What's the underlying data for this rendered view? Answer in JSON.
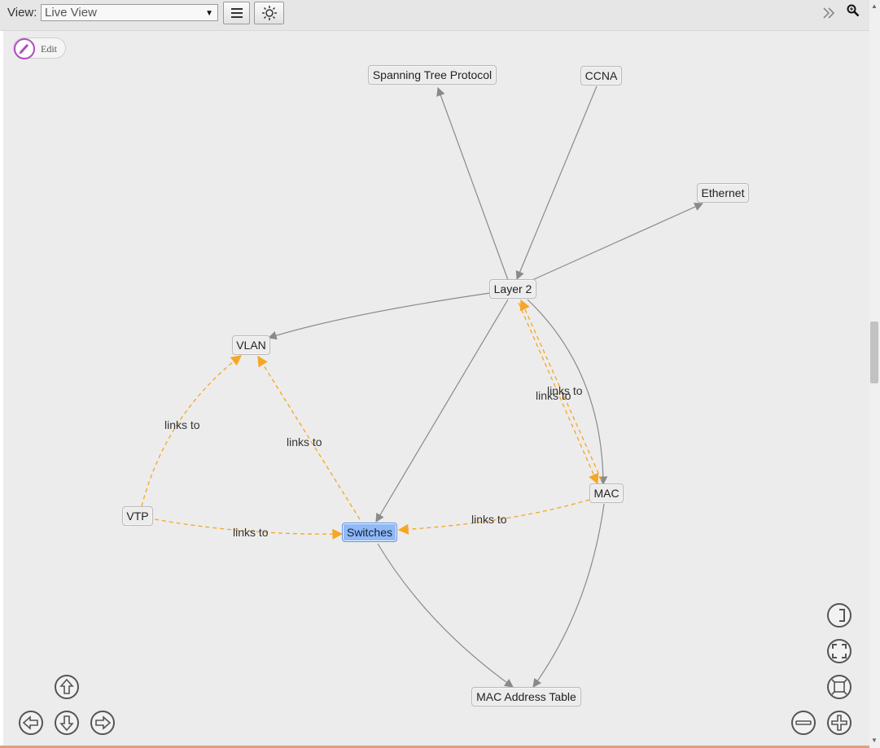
{
  "toolbar": {
    "view_label": "View:",
    "view_value": "Live View"
  },
  "edit_label": "Edit",
  "nodes": {
    "stp": "Spanning Tree Protocol",
    "ccna": "CCNA",
    "ethernet": "Ethernet",
    "layer2": "Layer 2",
    "vlan": "VLAN",
    "mac": "MAC",
    "vtp": "VTP",
    "switches": "Switches",
    "mac_table": "MAC Address Table"
  },
  "edge_labels": {
    "vtp_vlan": "links to",
    "switches_vlan": "links to",
    "layer2_mac_a": "links to",
    "layer2_mac_b": "links to",
    "mac_switches": "links to",
    "vtp_switches": "links to"
  },
  "colors": {
    "plain_edge": "#8a8a8a",
    "links_edge": "#f5a623",
    "selected_node": "#8fb9f7"
  },
  "icons": {
    "menu": "hamburger-icon",
    "theme": "sun-icon",
    "expand": "double-chevron-right-icon",
    "search": "zoom-search-icon",
    "edit": "pencil-icon"
  }
}
